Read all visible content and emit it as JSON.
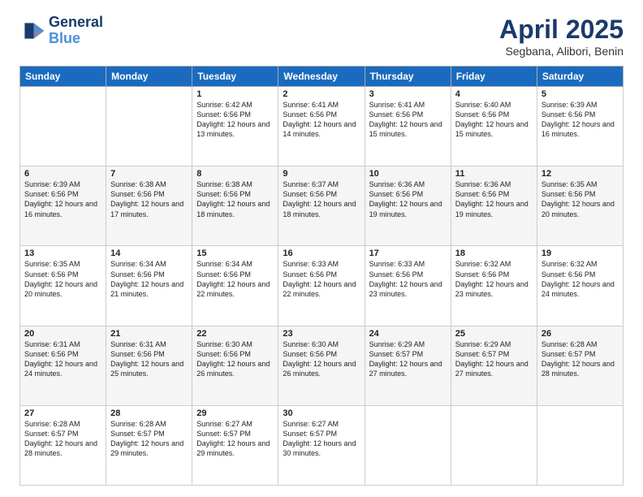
{
  "header": {
    "logo_line1": "General",
    "logo_line2": "Blue",
    "main_title": "April 2025",
    "subtitle": "Segbana, Alibori, Benin"
  },
  "weekdays": [
    "Sunday",
    "Monday",
    "Tuesday",
    "Wednesday",
    "Thursday",
    "Friday",
    "Saturday"
  ],
  "weeks": [
    [
      {
        "day": "",
        "sunrise": "",
        "sunset": "",
        "daylight": ""
      },
      {
        "day": "",
        "sunrise": "",
        "sunset": "",
        "daylight": ""
      },
      {
        "day": "1",
        "sunrise": "Sunrise: 6:42 AM",
        "sunset": "Sunset: 6:56 PM",
        "daylight": "Daylight: 12 hours and 13 minutes."
      },
      {
        "day": "2",
        "sunrise": "Sunrise: 6:41 AM",
        "sunset": "Sunset: 6:56 PM",
        "daylight": "Daylight: 12 hours and 14 minutes."
      },
      {
        "day": "3",
        "sunrise": "Sunrise: 6:41 AM",
        "sunset": "Sunset: 6:56 PM",
        "daylight": "Daylight: 12 hours and 15 minutes."
      },
      {
        "day": "4",
        "sunrise": "Sunrise: 6:40 AM",
        "sunset": "Sunset: 6:56 PM",
        "daylight": "Daylight: 12 hours and 15 minutes."
      },
      {
        "day": "5",
        "sunrise": "Sunrise: 6:39 AM",
        "sunset": "Sunset: 6:56 PM",
        "daylight": "Daylight: 12 hours and 16 minutes."
      }
    ],
    [
      {
        "day": "6",
        "sunrise": "Sunrise: 6:39 AM",
        "sunset": "Sunset: 6:56 PM",
        "daylight": "Daylight: 12 hours and 16 minutes."
      },
      {
        "day": "7",
        "sunrise": "Sunrise: 6:38 AM",
        "sunset": "Sunset: 6:56 PM",
        "daylight": "Daylight: 12 hours and 17 minutes."
      },
      {
        "day": "8",
        "sunrise": "Sunrise: 6:38 AM",
        "sunset": "Sunset: 6:56 PM",
        "daylight": "Daylight: 12 hours and 18 minutes."
      },
      {
        "day": "9",
        "sunrise": "Sunrise: 6:37 AM",
        "sunset": "Sunset: 6:56 PM",
        "daylight": "Daylight: 12 hours and 18 minutes."
      },
      {
        "day": "10",
        "sunrise": "Sunrise: 6:36 AM",
        "sunset": "Sunset: 6:56 PM",
        "daylight": "Daylight: 12 hours and 19 minutes."
      },
      {
        "day": "11",
        "sunrise": "Sunrise: 6:36 AM",
        "sunset": "Sunset: 6:56 PM",
        "daylight": "Daylight: 12 hours and 19 minutes."
      },
      {
        "day": "12",
        "sunrise": "Sunrise: 6:35 AM",
        "sunset": "Sunset: 6:56 PM",
        "daylight": "Daylight: 12 hours and 20 minutes."
      }
    ],
    [
      {
        "day": "13",
        "sunrise": "Sunrise: 6:35 AM",
        "sunset": "Sunset: 6:56 PM",
        "daylight": "Daylight: 12 hours and 20 minutes."
      },
      {
        "day": "14",
        "sunrise": "Sunrise: 6:34 AM",
        "sunset": "Sunset: 6:56 PM",
        "daylight": "Daylight: 12 hours and 21 minutes."
      },
      {
        "day": "15",
        "sunrise": "Sunrise: 6:34 AM",
        "sunset": "Sunset: 6:56 PM",
        "daylight": "Daylight: 12 hours and 22 minutes."
      },
      {
        "day": "16",
        "sunrise": "Sunrise: 6:33 AM",
        "sunset": "Sunset: 6:56 PM",
        "daylight": "Daylight: 12 hours and 22 minutes."
      },
      {
        "day": "17",
        "sunrise": "Sunrise: 6:33 AM",
        "sunset": "Sunset: 6:56 PM",
        "daylight": "Daylight: 12 hours and 23 minutes."
      },
      {
        "day": "18",
        "sunrise": "Sunrise: 6:32 AM",
        "sunset": "Sunset: 6:56 PM",
        "daylight": "Daylight: 12 hours and 23 minutes."
      },
      {
        "day": "19",
        "sunrise": "Sunrise: 6:32 AM",
        "sunset": "Sunset: 6:56 PM",
        "daylight": "Daylight: 12 hours and 24 minutes."
      }
    ],
    [
      {
        "day": "20",
        "sunrise": "Sunrise: 6:31 AM",
        "sunset": "Sunset: 6:56 PM",
        "daylight": "Daylight: 12 hours and 24 minutes."
      },
      {
        "day": "21",
        "sunrise": "Sunrise: 6:31 AM",
        "sunset": "Sunset: 6:56 PM",
        "daylight": "Daylight: 12 hours and 25 minutes."
      },
      {
        "day": "22",
        "sunrise": "Sunrise: 6:30 AM",
        "sunset": "Sunset: 6:56 PM",
        "daylight": "Daylight: 12 hours and 26 minutes."
      },
      {
        "day": "23",
        "sunrise": "Sunrise: 6:30 AM",
        "sunset": "Sunset: 6:56 PM",
        "daylight": "Daylight: 12 hours and 26 minutes."
      },
      {
        "day": "24",
        "sunrise": "Sunrise: 6:29 AM",
        "sunset": "Sunset: 6:57 PM",
        "daylight": "Daylight: 12 hours and 27 minutes."
      },
      {
        "day": "25",
        "sunrise": "Sunrise: 6:29 AM",
        "sunset": "Sunset: 6:57 PM",
        "daylight": "Daylight: 12 hours and 27 minutes."
      },
      {
        "day": "26",
        "sunrise": "Sunrise: 6:28 AM",
        "sunset": "Sunset: 6:57 PM",
        "daylight": "Daylight: 12 hours and 28 minutes."
      }
    ],
    [
      {
        "day": "27",
        "sunrise": "Sunrise: 6:28 AM",
        "sunset": "Sunset: 6:57 PM",
        "daylight": "Daylight: 12 hours and 28 minutes."
      },
      {
        "day": "28",
        "sunrise": "Sunrise: 6:28 AM",
        "sunset": "Sunset: 6:57 PM",
        "daylight": "Daylight: 12 hours and 29 minutes."
      },
      {
        "day": "29",
        "sunrise": "Sunrise: 6:27 AM",
        "sunset": "Sunset: 6:57 PM",
        "daylight": "Daylight: 12 hours and 29 minutes."
      },
      {
        "day": "30",
        "sunrise": "Sunrise: 6:27 AM",
        "sunset": "Sunset: 6:57 PM",
        "daylight": "Daylight: 12 hours and 30 minutes."
      },
      {
        "day": "",
        "sunrise": "",
        "sunset": "",
        "daylight": ""
      },
      {
        "day": "",
        "sunrise": "",
        "sunset": "",
        "daylight": ""
      },
      {
        "day": "",
        "sunrise": "",
        "sunset": "",
        "daylight": ""
      }
    ]
  ]
}
